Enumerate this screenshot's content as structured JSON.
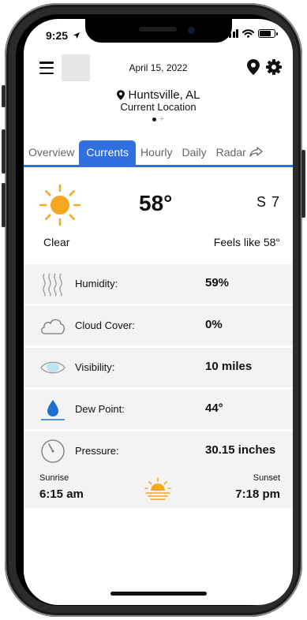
{
  "status_bar": {
    "time": "9:25"
  },
  "header": {
    "date": "April 15, 2022"
  },
  "location": {
    "city": "Huntsville, AL",
    "subtitle": "Current Location"
  },
  "tabs": [
    {
      "label": "Overview",
      "active": false
    },
    {
      "label": "Currents",
      "active": true
    },
    {
      "label": "Hourly",
      "active": false
    },
    {
      "label": "Daily",
      "active": false
    },
    {
      "label": "Radar",
      "active": false
    }
  ],
  "current": {
    "temperature": "58°",
    "wind": "S 7",
    "condition": "Clear",
    "feels_like": "Feels like 58°"
  },
  "details": [
    {
      "icon": "humidity-icon",
      "label": "Humidity:",
      "value": "59%"
    },
    {
      "icon": "cloud-icon",
      "label": "Cloud Cover:",
      "value": "0%"
    },
    {
      "icon": "eye-icon",
      "label": "Visibility:",
      "value": "10 miles"
    },
    {
      "icon": "dew-drop-icon",
      "label": "Dew Point:",
      "value": "44°"
    },
    {
      "icon": "gauge-icon",
      "label": "Pressure:",
      "value": "30.15 inches"
    }
  ],
  "sun": {
    "sunrise_label": "Sunrise",
    "sunrise": "6:15 am",
    "sunset_label": "Sunset",
    "sunset": "7:18 pm"
  },
  "colors": {
    "accent": "#2f6fe0",
    "sun": "#f5a623",
    "row_bg": "#f3f3f3"
  }
}
